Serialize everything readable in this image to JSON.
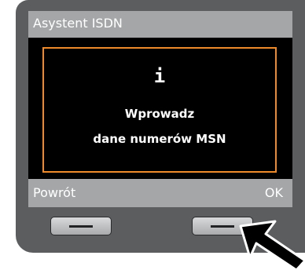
{
  "screen": {
    "title": "Asystent ISDN",
    "dialog": {
      "icon": "info-icon",
      "icon_glyph": "i",
      "message_line1": "Wprowadz",
      "message_line2": "dane numerów MSN"
    },
    "softkeys": {
      "left_label": "Powrót",
      "right_label": "OK"
    }
  },
  "colors": {
    "device_body": "#5b5d5f",
    "bar_gray": "#a4a6a8",
    "screen_bg": "#000000",
    "dialog_border": "#ef8a2b",
    "text": "#ffffff",
    "arrow": "#000000"
  },
  "icons": [
    "info-icon",
    "dash-icon",
    "pointer-arrow-icon"
  ]
}
